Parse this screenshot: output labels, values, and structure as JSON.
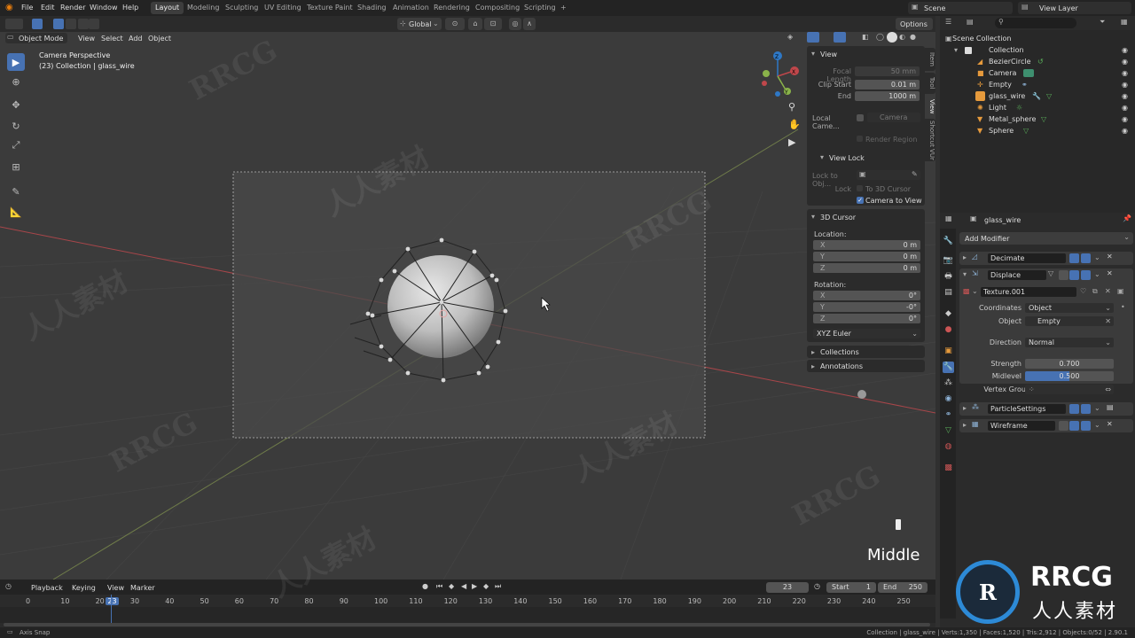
{
  "watermark": {
    "text_latin": "RRCG",
    "text_cjk": "人人素材"
  },
  "topbar": {
    "menus": [
      "File",
      "Edit",
      "Render",
      "Window",
      "Help"
    ],
    "workspaces": [
      "Layout",
      "Modeling",
      "Sculpting",
      "UV Editing",
      "Texture Paint",
      "Shading",
      "Animation",
      "Rendering",
      "Compositing",
      "Scripting"
    ],
    "active_workspace": "Layout",
    "add_tab": "+",
    "scene": "Scene",
    "view_layer": "View Layer"
  },
  "transform_bar": {
    "orientation": "Global",
    "options": "Options"
  },
  "viewport_header": {
    "mode": "Object Mode",
    "menus": [
      "View",
      "Select",
      "Add",
      "Object"
    ]
  },
  "viewport": {
    "line1": "Camera Perspective",
    "line2": "(23) Collection | glass_wire",
    "key_label": "Middle",
    "gizmo_axes": [
      "X",
      "Y",
      "Z"
    ]
  },
  "npanel": {
    "view": {
      "title": "View",
      "focal_label": "Focal Length",
      "focal_value": "50 mm",
      "clip_start_label": "Clip Start",
      "clip_start_value": "0.01 m",
      "end_label": "End",
      "end_value": "1000 m",
      "local_camera_label": "Local Came...",
      "local_camera_value": "Camera",
      "render_region": "Render Region"
    },
    "view_lock": {
      "title": "View Lock",
      "lock_to_obj_label": "Lock to Obj...",
      "lock_label": "Lock",
      "to_3d_cursor": "To 3D Cursor",
      "camera_to_view": "Camera to View"
    },
    "cursor": {
      "title": "3D Cursor",
      "location_label": "Location:",
      "x_label": "X",
      "x_value": "0 m",
      "y_label": "Y",
      "y_value": "0 m",
      "z_label": "Z",
      "z_value": "0 m",
      "rotation_label": "Rotation:",
      "rx_value": "0°",
      "ry_value": "-0°",
      "rz_value": "0°",
      "mode": "XYZ Euler"
    },
    "collections": "Collections",
    "annotations": "Annotations",
    "tabs": [
      "Item",
      "Tool",
      "View",
      "Shortcut VUr"
    ]
  },
  "outliner": {
    "root": "Scene Collection",
    "collection": "Collection",
    "items": [
      "BezierCircle",
      "Camera",
      "Empty",
      "glass_wire",
      "Light",
      "Metal_sphere",
      "Sphere"
    ],
    "eye": "◉"
  },
  "properties": {
    "object_name": "glass_wire",
    "add_modifier": "Add Modifier",
    "modifiers": [
      "Decimate",
      "Displace",
      "ParticleSettings",
      "Wireframe"
    ],
    "texture": "Texture.001",
    "coordinates_label": "Coordinates",
    "coordinates_value": "Object",
    "object_label": "Object",
    "object_value": "Empty",
    "direction_label": "Direction",
    "direction_value": "Normal",
    "strength_label": "Strength",
    "strength_value": "0.700",
    "midlevel_label": "Midlevel",
    "midlevel_value": "0.500",
    "vertex_group_label": "Vertex Group"
  },
  "timeline": {
    "menus": [
      "Playback",
      "Keying",
      "View",
      "Marker"
    ],
    "current_frame": "23",
    "start_label": "Start",
    "start_value": "1",
    "end_label": "End",
    "end_value": "250",
    "ticks": [
      "0",
      "10",
      "20",
      "23",
      "30",
      "40",
      "50",
      "60",
      "70",
      "80",
      "90",
      "100",
      "110",
      "120",
      "130",
      "140",
      "150",
      "160",
      "170",
      "180",
      "190",
      "200",
      "210",
      "220",
      "230",
      "240",
      "250"
    ]
  },
  "statusbar": {
    "left": "Axis Snap",
    "right": "Collection | glass_wire | Verts:1,350 | Faces:1,520 | Tris:2,912 | Objects:0/52 | 2.90.1"
  },
  "colors": {
    "accent": "#4772b3",
    "x_axis": "#c0474b",
    "y_axis": "#8ab34a",
    "z_axis": "#2e78c6"
  }
}
